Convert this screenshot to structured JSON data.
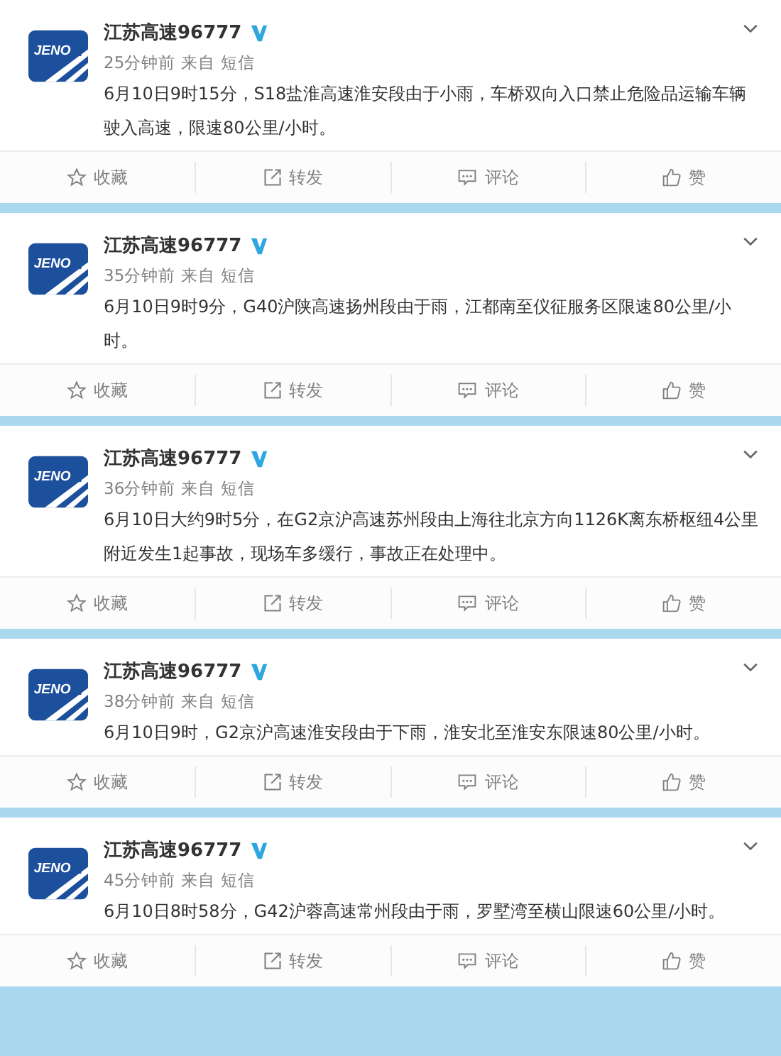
{
  "posts": [
    {
      "logo_text": "JENO",
      "author": "江苏高速96777",
      "verified": true,
      "time": "25分钟前",
      "source": "来自 短信",
      "text": "6月10日9时15分，S18盐淮高速淮安段由于小雨，车桥双向入口禁止危险品运输车辆驶入高速，限速80公里/小时。",
      "actions": [
        {
          "kind": "favorite",
          "label": "收藏"
        },
        {
          "kind": "repost",
          "label": "转发"
        },
        {
          "kind": "comment",
          "label": "评论"
        },
        {
          "kind": "like",
          "label": "赞"
        }
      ]
    },
    {
      "logo_text": "JENO",
      "author": "江苏高速96777",
      "verified": true,
      "time": "35分钟前",
      "source": "来自 短信",
      "text": "6月10日9时9分，G40沪陕高速扬州段由于雨，江都南至仪征服务区限速80公里/小时。",
      "actions": [
        {
          "kind": "favorite",
          "label": "收藏"
        },
        {
          "kind": "repost",
          "label": "转发"
        },
        {
          "kind": "comment",
          "label": "评论"
        },
        {
          "kind": "like",
          "label": "赞"
        }
      ]
    },
    {
      "logo_text": "JENO",
      "author": "江苏高速96777",
      "verified": true,
      "time": "36分钟前",
      "source": "来自 短信",
      "text": "6月10日大约9时5分，在G2京沪高速苏州段由上海往北京方向1126K离东桥枢纽4公里附近发生1起事故，现场车多缓行，事故正在处理中。",
      "actions": [
        {
          "kind": "favorite",
          "label": "收藏"
        },
        {
          "kind": "repost",
          "label": "转发"
        },
        {
          "kind": "comment",
          "label": "评论"
        },
        {
          "kind": "like",
          "label": "赞"
        }
      ]
    },
    {
      "logo_text": "JENO",
      "author": "江苏高速96777",
      "verified": true,
      "time": "38分钟前",
      "source": "来自 短信",
      "text": "6月10日9时，G2京沪高速淮安段由于下雨，淮安北至淮安东限速80公里/小时。",
      "actions": [
        {
          "kind": "favorite",
          "label": "收藏"
        },
        {
          "kind": "repost",
          "label": "转发"
        },
        {
          "kind": "comment",
          "label": "评论"
        },
        {
          "kind": "like",
          "label": "赞"
        }
      ]
    },
    {
      "logo_text": "JENO",
      "author": "江苏高速96777",
      "verified": true,
      "time": "45分钟前",
      "source": "来自 短信",
      "text": "6月10日8时58分，G42沪蓉高速常州段由于雨，罗墅湾至横山限速60公里/小时。",
      "actions": [
        {
          "kind": "favorite",
          "label": "收藏"
        },
        {
          "kind": "repost",
          "label": "转发"
        },
        {
          "kind": "comment",
          "label": "评论"
        },
        {
          "kind": "like",
          "label": "赞"
        }
      ]
    }
  ]
}
